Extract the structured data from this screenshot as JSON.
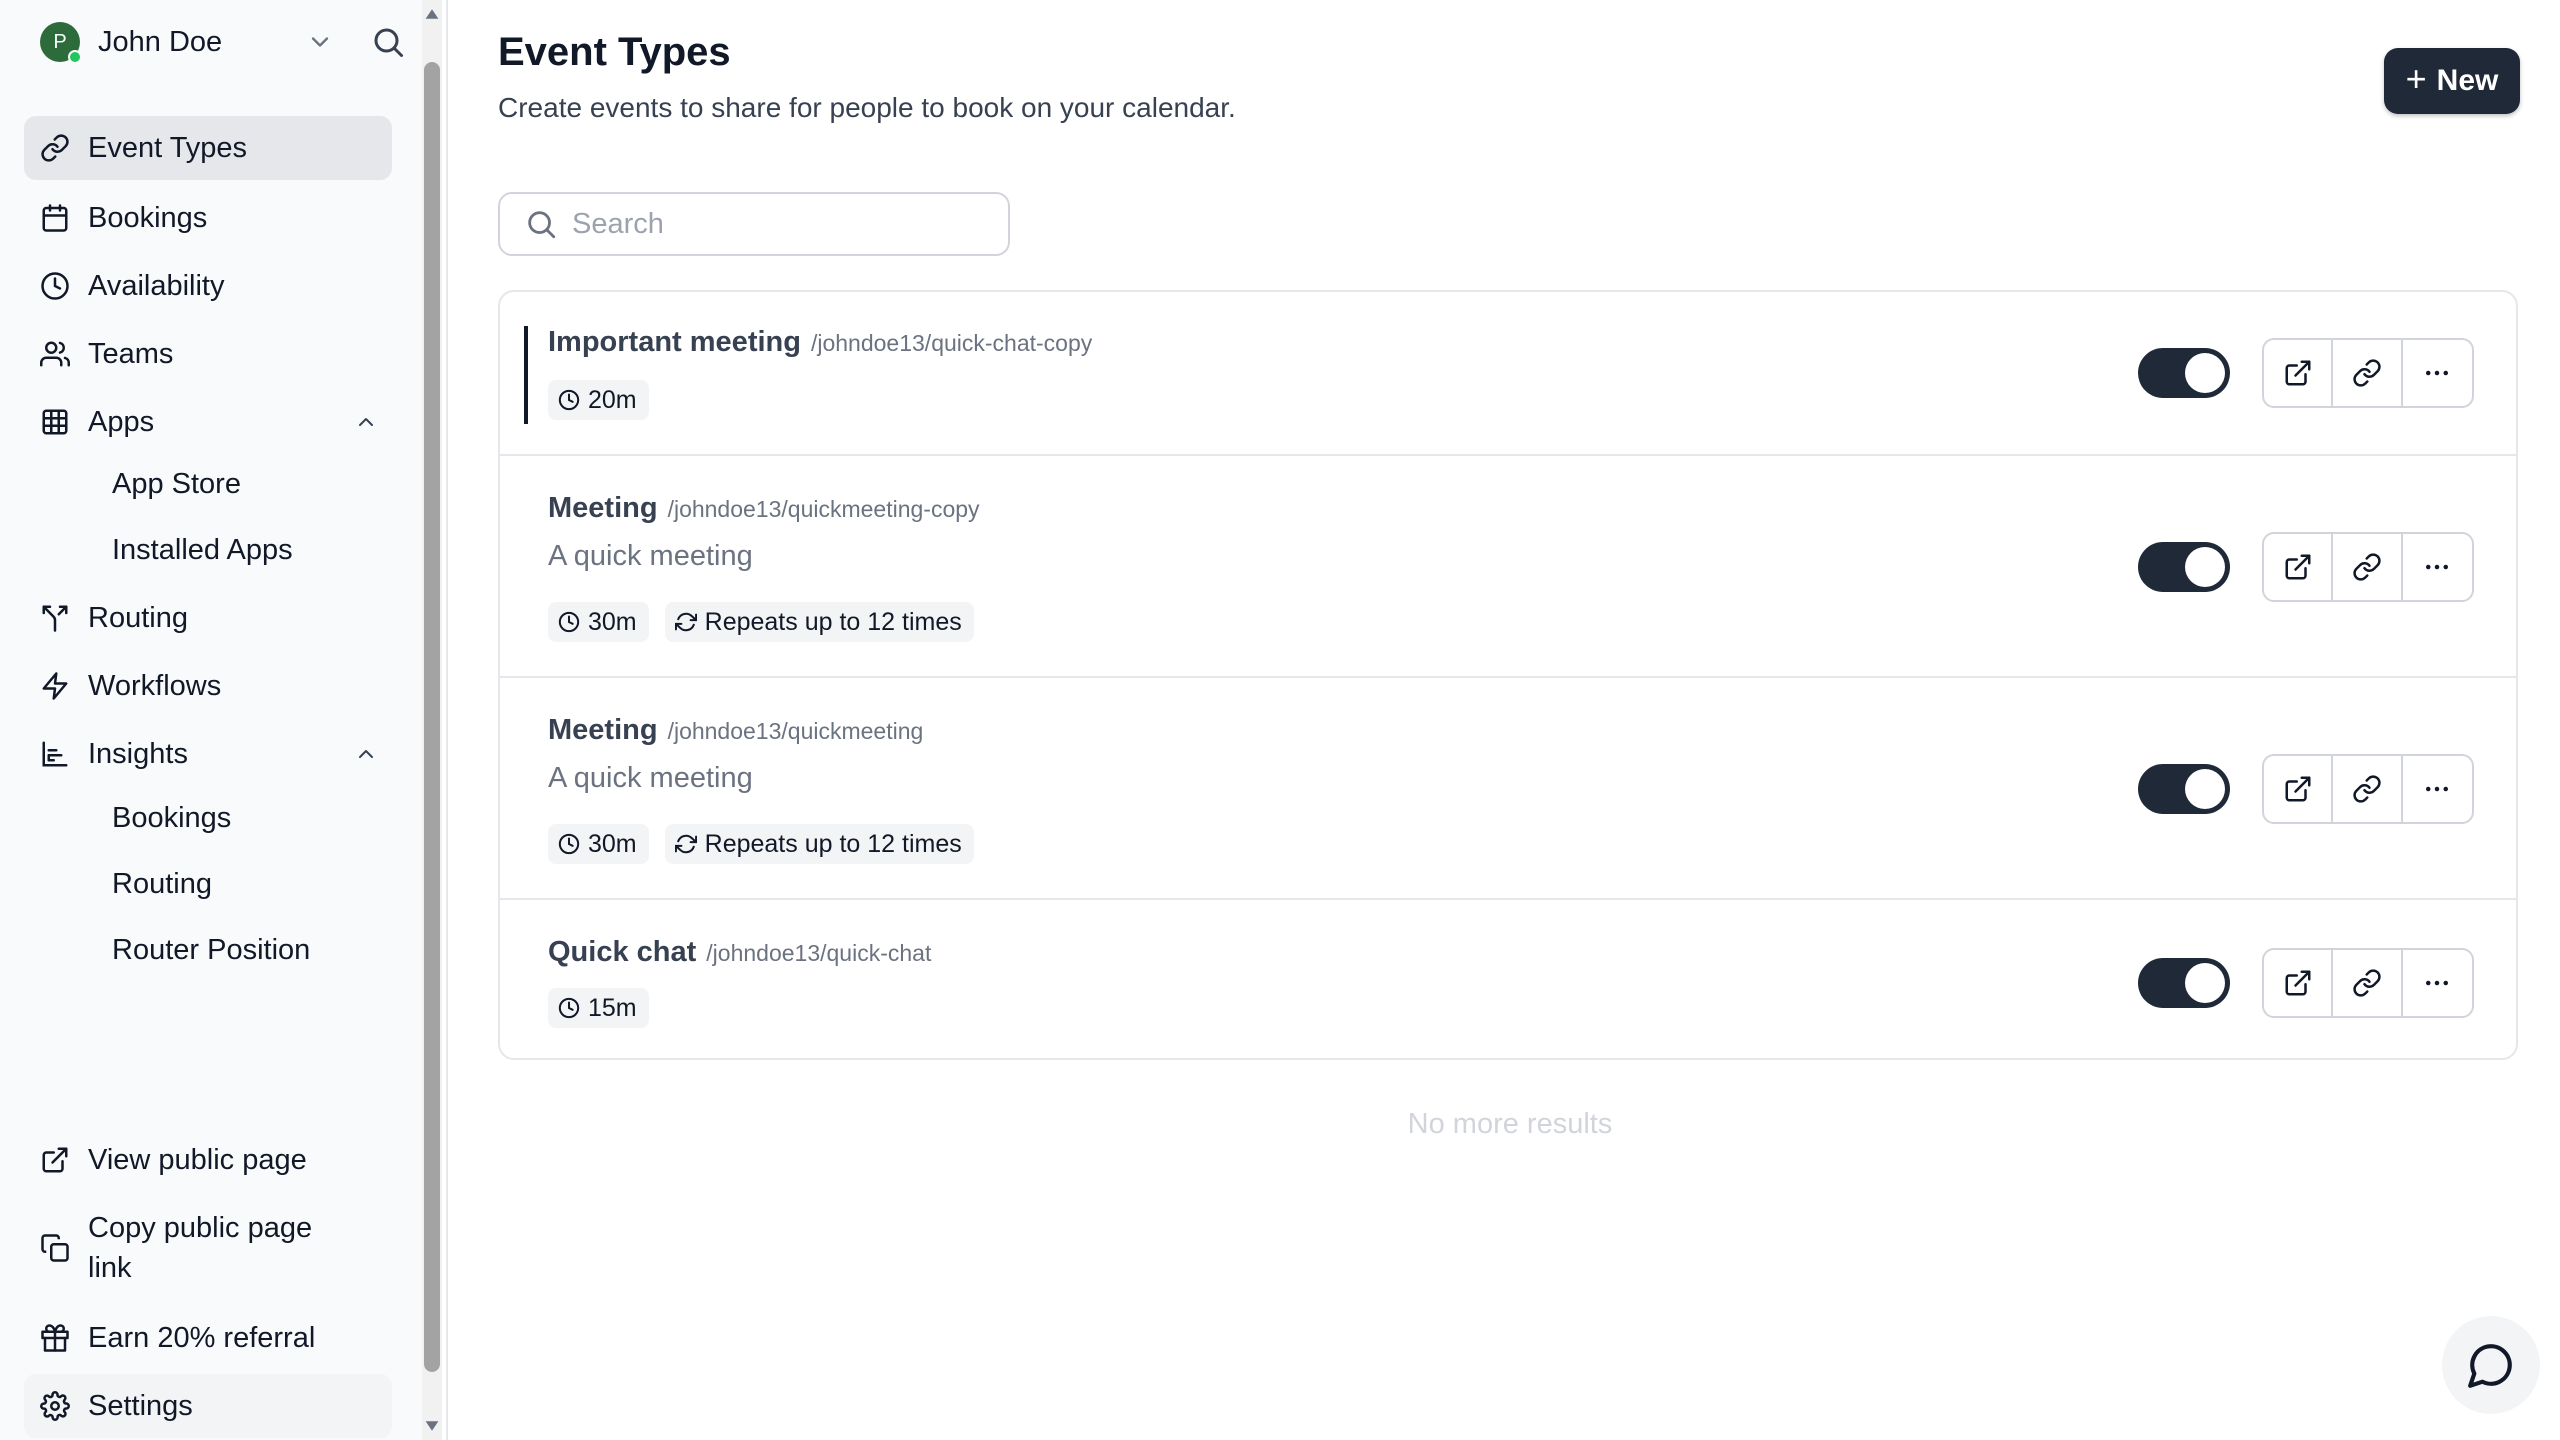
{
  "user": {
    "name": "John Doe",
    "initial": "P"
  },
  "nav": {
    "event_types": "Event Types",
    "bookings": "Bookings",
    "availability": "Availability",
    "teams": "Teams",
    "apps": "Apps",
    "apps_sub": [
      "App Store",
      "Installed Apps"
    ],
    "routing": "Routing",
    "workflows": "Workflows",
    "insights": "Insights",
    "insights_sub": [
      "Bookings",
      "Routing",
      "Router Position"
    ],
    "view_public_page": "View public page",
    "copy_public_page_link": "Copy public page link",
    "earn_referral": "Earn 20% referral",
    "settings": "Settings"
  },
  "header": {
    "title": "Event Types",
    "subtitle": "Create events to share for people to book on your calendar.",
    "new_button": "New"
  },
  "search": {
    "placeholder": "Search",
    "value": ""
  },
  "events": [
    {
      "title": "Important meeting",
      "slug": "/johndoe13/quick-chat-copy",
      "description": "",
      "duration": "20m",
      "repeats": "",
      "enabled": true
    },
    {
      "title": "Meeting",
      "slug": "/johndoe13/quickmeeting-copy",
      "description": "A quick meeting",
      "duration": "30m",
      "repeats": "Repeats up to 12 times",
      "enabled": true
    },
    {
      "title": "Meeting",
      "slug": "/johndoe13/quickmeeting",
      "description": "A quick meeting",
      "duration": "30m",
      "repeats": "Repeats up to 12 times",
      "enabled": true
    },
    {
      "title": "Quick chat",
      "slug": "/johndoe13/quick-chat",
      "description": "",
      "duration": "15m",
      "repeats": "",
      "enabled": true
    }
  ],
  "list_footer": "No more results",
  "icons": {
    "event_types": "link-icon",
    "bookings": "calendar-icon",
    "availability": "clock-icon",
    "teams": "users-icon",
    "apps": "grid-icon",
    "routing": "split-icon",
    "workflows": "zap-icon",
    "insights": "bar-chart-icon",
    "view_public_page": "external-link-icon",
    "copy_link": "copy-icon",
    "referral": "gift-icon",
    "settings": "gear-icon",
    "chat": "chat-bubble-icon"
  },
  "colors": {
    "primary": "#1f2937",
    "active_nav": "#e5e7eb",
    "status_online": "#22c55e",
    "avatar": "#2e6b3a"
  }
}
